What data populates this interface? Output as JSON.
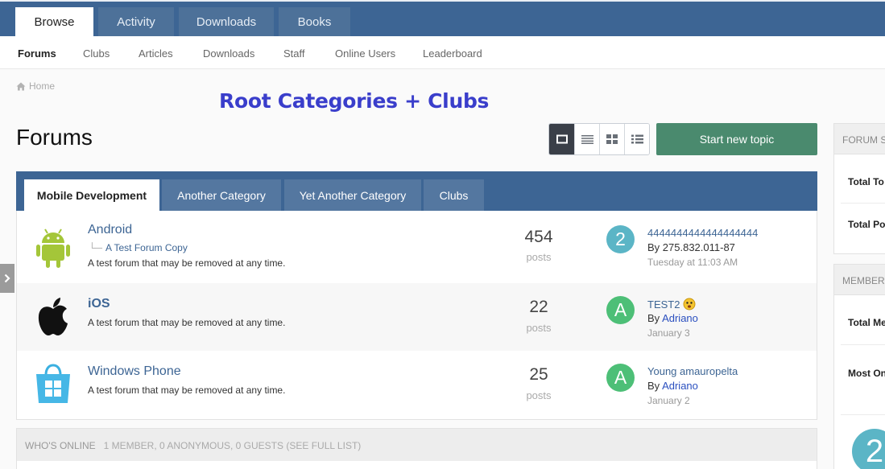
{
  "main_tabs": [
    {
      "label": "Browse",
      "active": true
    },
    {
      "label": "Activity",
      "active": false
    },
    {
      "label": "Downloads",
      "active": false
    },
    {
      "label": "Books",
      "active": false
    }
  ],
  "sub_nav": [
    "Forums",
    "Clubs",
    "Articles",
    "Downloads",
    "Staff",
    "Online Users",
    "Leaderboard"
  ],
  "breadcrumb": {
    "home_label": "Home",
    "icon": "home-icon"
  },
  "annotation": "Root Categories + Clubs",
  "page_title": "Forums",
  "view_modes": [
    "fluid-view-icon",
    "table-view-icon",
    "grid-view-icon",
    "list-view-icon"
  ],
  "new_topic_label": "Start new topic",
  "category_tabs": [
    {
      "label": "Mobile Development",
      "active": true
    },
    {
      "label": "Another Category",
      "active": false
    },
    {
      "label": "Yet Another Category",
      "active": false
    },
    {
      "label": "Clubs",
      "active": false
    }
  ],
  "forums": [
    {
      "name": "Android",
      "icon": "android-icon",
      "subforum": "A Test Forum Copy",
      "description": "A test forum that may be removed at any time.",
      "count": "454",
      "count_label": "posts",
      "last_post": {
        "avatar_letter": "2",
        "avatar_color": "#5bb5c6",
        "title": "4444444444444444444",
        "by_text": "By 275.832.011-87",
        "by_prefix": "",
        "user": "",
        "date": "Tuesday at 11:03 AM"
      }
    },
    {
      "name": "iOS",
      "icon": "apple-icon",
      "subforum": "",
      "description": "A test forum that may be removed at any time.",
      "count": "22",
      "count_label": "posts",
      "last_post": {
        "avatar_letter": "A",
        "avatar_color": "#4dbf77",
        "title": "TEST2",
        "by_text": "",
        "by_prefix": "By",
        "user": "Adriano",
        "date": "January 3"
      }
    },
    {
      "name": "Windows Phone",
      "icon": "windows-store-icon",
      "subforum": "",
      "description": "A test forum that may be removed at any time.",
      "count": "25",
      "count_label": "posts",
      "last_post": {
        "avatar_letter": "A",
        "avatar_color": "#4dbf77",
        "title": "Young amauropelta",
        "by_text": "",
        "by_prefix": "By",
        "user": "Adriano",
        "date": "January 2"
      }
    }
  ],
  "online": {
    "title": "WHO'S ONLINE",
    "summary": "1 MEMBER, 0 ANONYMOUS, 0 GUESTS (SEE FULL LIST)"
  },
  "sidebar": {
    "forum_stats": {
      "title": "FORUM ST",
      "rows": [
        "Total To",
        "Total Po"
      ]
    },
    "member_stats": {
      "title": "MEMBER S",
      "rows": [
        "Total Me",
        "Most On"
      ]
    },
    "avatar_letter": "2"
  },
  "colors": {
    "brand": "#3d6594",
    "new_topic": "#4a8a6e",
    "annotation": "#3a3ecb",
    "link": "#3d6594"
  }
}
